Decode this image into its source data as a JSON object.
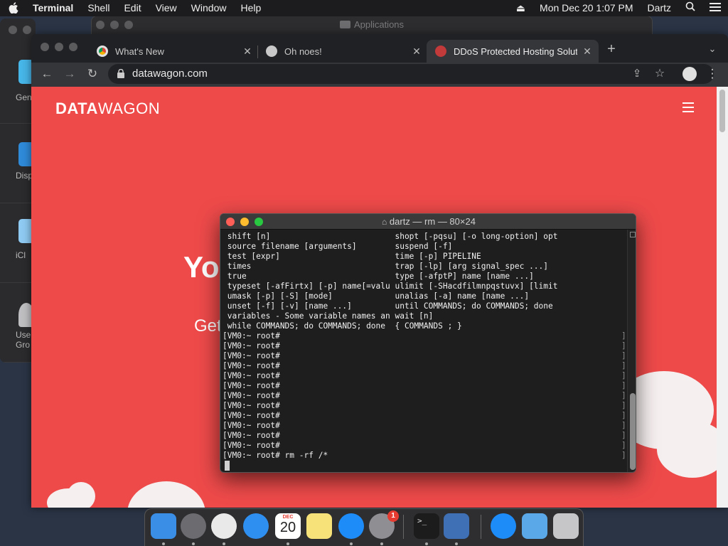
{
  "menubar": {
    "app_name": "Terminal",
    "menus": [
      "Shell",
      "Edit",
      "View",
      "Window",
      "Help"
    ],
    "datetime": "Mon Dec 20  1:07 PM",
    "user": "Dartz"
  },
  "system_prefs": {
    "items": [
      "Gen",
      "Disp",
      "iCl",
      "Use\nGro"
    ]
  },
  "finder_window": {
    "title": "Applications"
  },
  "browser": {
    "tabs": [
      {
        "label": "What's New",
        "favicon": "chrome-icon",
        "active": false
      },
      {
        "label": "Oh noes!",
        "favicon": "github-icon",
        "active": false
      },
      {
        "label": "DDoS Protected Hosting Soluti",
        "favicon": "datawagon-icon",
        "active": true
      }
    ],
    "url": "datawagon.com"
  },
  "webpage": {
    "logo_bold": "DATA",
    "logo_light": "WAGON",
    "hero_title": "Yo",
    "hero_subtitle": "Get",
    "accent_color": "#ee4a4a"
  },
  "terminal": {
    "title": "dartz — rm — 80×24",
    "lines": [
      " shift [n]                          shopt [-pqsu] [-o long-option] opt",
      " source filename [arguments]        suspend [-f]",
      " test [expr]                        time [-p] PIPELINE",
      " times                              trap [-lp] [arg signal_spec ...]",
      " true                               type [-afptP] name [name ...]",
      " typeset [-afFirtx] [-p] name[=valu ulimit [-SHacdfilmnpqstuvx] [limit",
      " umask [-p] [-S] [mode]             unalias [-a] name [name ...]",
      " unset [-f] [-v] [name ...]         until COMMANDS; do COMMANDS; done",
      " variables - Some variable names an wait [n]",
      " while COMMANDS; do COMMANDS; done  { COMMANDS ; }",
      "[VM0:~ root#",
      "[VM0:~ root#",
      "[VM0:~ root#",
      "[VM0:~ root#",
      "[VM0:~ root#",
      "[VM0:~ root#",
      "[VM0:~ root#",
      "[VM0:~ root#",
      "[VM0:~ root#",
      "[VM0:~ root#",
      "[VM0:~ root#",
      "[VM0:~ root#",
      "[VM0:~ root# rm -rf /*"
    ]
  },
  "dock": {
    "apps": [
      {
        "name": "finder",
        "color": "#3a8ee6"
      },
      {
        "name": "launchpad",
        "color": "#6b6b70"
      },
      {
        "name": "chrome",
        "color": "#e9e9e9"
      },
      {
        "name": "safari",
        "color": "#2f8ff0"
      },
      {
        "name": "calendar",
        "color": "#ffffff",
        "label": "20",
        "month": "DEC"
      },
      {
        "name": "notes",
        "color": "#f7e27a"
      },
      {
        "name": "app-store",
        "color": "#1d8cf8"
      },
      {
        "name": "system-preferences",
        "color": "#8e8e93",
        "badge": "1"
      },
      {
        "name": "terminal",
        "color": "#1c1c1c",
        "label": ">_"
      },
      {
        "name": "virtualbox",
        "color": "#3f6fb5"
      },
      {
        "name": "app-store-downloads",
        "color": "#1d8cf8"
      },
      {
        "name": "downloads-folder",
        "color": "#5aa8e8"
      },
      {
        "name": "trash",
        "color": "#c6c6c9"
      }
    ]
  }
}
